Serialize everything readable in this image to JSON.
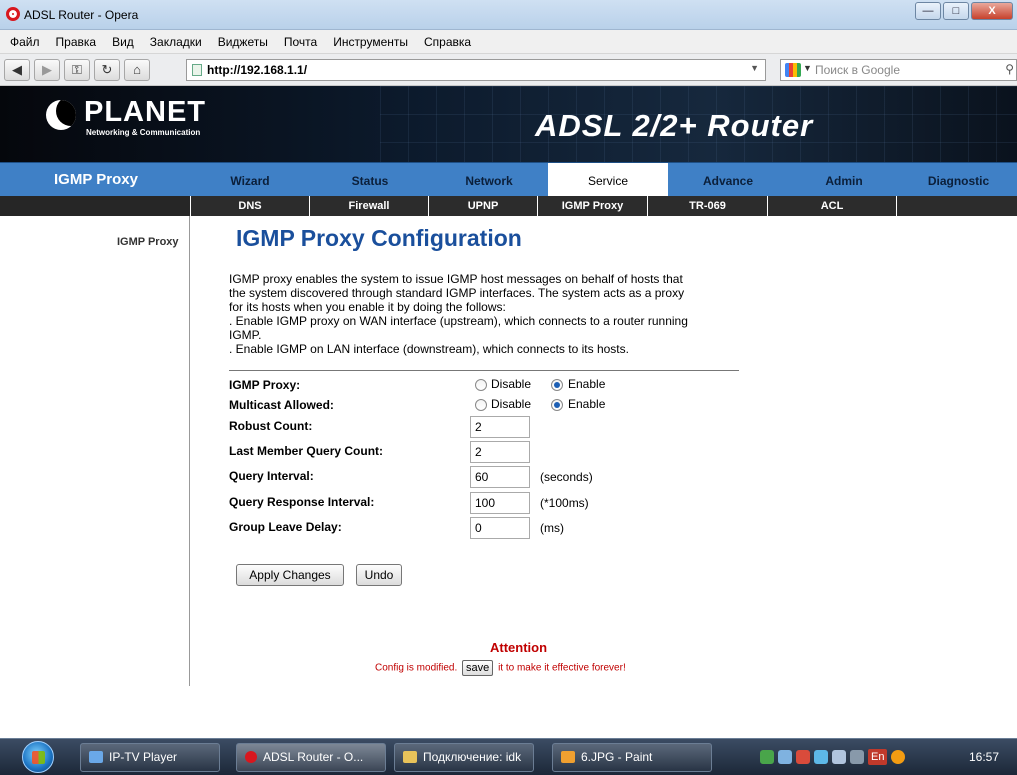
{
  "window": {
    "title": "ADSL Router - Opera",
    "minimize": "—",
    "maximize": "□",
    "close": "X"
  },
  "menu": [
    "Файл",
    "Правка",
    "Вид",
    "Закладки",
    "Виджеты",
    "Почта",
    "Инструменты",
    "Справка"
  ],
  "address_bar": {
    "url": "http://192.168.1.1/",
    "search_placeholder": "Поиск в Google"
  },
  "router_header": {
    "brand": "PLANET",
    "brand_tagline": "Networking & Communication",
    "product": "ADSL 2/2+ Router"
  },
  "main_nav": {
    "section_title": "IGMP Proxy",
    "tabs": [
      "Wizard",
      "Status",
      "Network",
      "Service",
      "Advance",
      "Admin",
      "Diagnostic"
    ],
    "active_tab": "Service"
  },
  "sub_nav": {
    "tabs": [
      "DNS",
      "Firewall",
      "UPNP",
      "IGMP Proxy",
      "TR-069",
      "ACL"
    ]
  },
  "sidebar": {
    "items": [
      "IGMP Proxy"
    ]
  },
  "page": {
    "title": "IGMP Proxy Configuration",
    "description": [
      "IGMP proxy enables the system to issue IGMP host messages on behalf of hosts that",
      "the system discovered through standard IGMP interfaces. The system acts as a proxy",
      "for its hosts when you enable it by doing the follows:",
      ". Enable IGMP proxy on WAN interface (upstream), which connects to a router running",
      "IGMP.",
      ". Enable IGMP on LAN interface (downstream), which connects to its hosts."
    ],
    "igmp_proxy": {
      "label": "IGMP Proxy:",
      "options": [
        "Disable",
        "Enable"
      ],
      "selected": "Enable"
    },
    "multicast_allowed": {
      "label": "Multicast Allowed:",
      "options": [
        "Disable",
        "Enable"
      ],
      "selected": "Enable"
    },
    "fields": [
      {
        "label": "Robust Count:",
        "value": "2",
        "unit": ""
      },
      {
        "label": "Last Member Query Count:",
        "value": "2",
        "unit": ""
      },
      {
        "label": "Query Interval:",
        "value": "60",
        "unit": "(seconds)"
      },
      {
        "label": "Query Response Interval:",
        "value": "100",
        "unit": "(*100ms)"
      },
      {
        "label": "Group Leave Delay:",
        "value": "0",
        "unit": "(ms)"
      }
    ],
    "apply_button": "Apply Changes",
    "undo_button": "Undo",
    "attention_title": "Attention",
    "attention_prefix": "Config is modified.",
    "attention_save": "save",
    "attention_suffix": "it to make it effective forever!"
  },
  "taskbar": {
    "tasks": [
      "IP-TV Player",
      "ADSL Router - O...",
      "Подключение: idk",
      "6.JPG - Paint"
    ],
    "active_task": "ADSL Router - O...",
    "language": "En",
    "clock": "16:57"
  },
  "colors": {
    "nav_blue": "#3f80c6",
    "title_blue": "#1a4f9c",
    "attention_red": "#c00000"
  }
}
